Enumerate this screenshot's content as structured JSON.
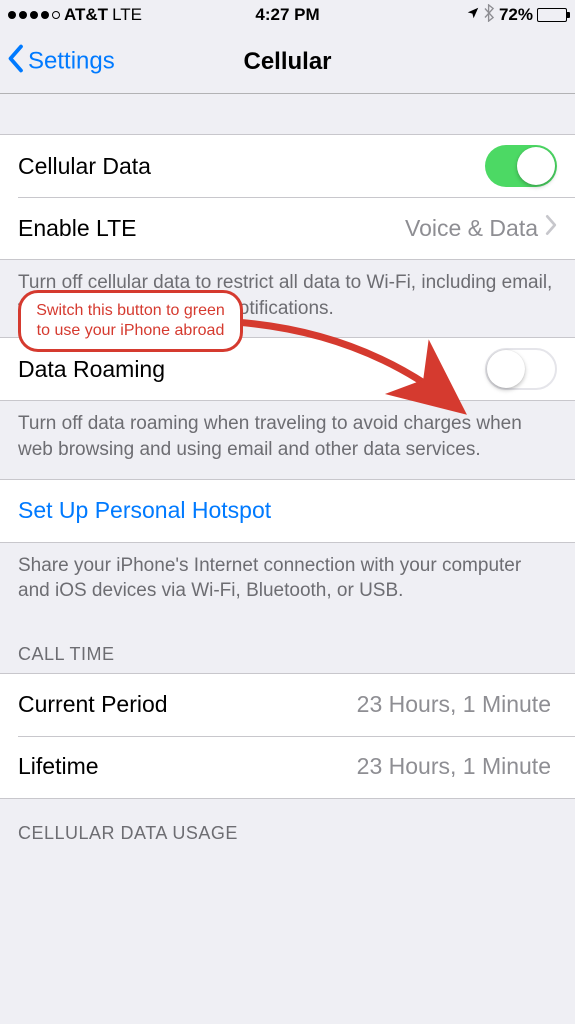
{
  "status": {
    "carrier": "AT&T",
    "network": "LTE",
    "time": "4:27 PM",
    "battery_pct": "72%"
  },
  "nav": {
    "back_label": "Settings",
    "title": "Cellular"
  },
  "rows": {
    "cellular_data": "Cellular Data",
    "enable_lte": "Enable LTE",
    "enable_lte_value": "Voice & Data",
    "cellular_data_footer": "Turn off cellular data to restrict all data to Wi-Fi, including email, web browsing, and push notifications.",
    "data_roaming": "Data Roaming",
    "data_roaming_footer": "Turn off data roaming when traveling to avoid charges when web browsing and using email and other data services.",
    "hotspot": "Set Up Personal Hotspot",
    "hotspot_footer": "Share your iPhone's Internet connection with your computer and iOS devices via Wi-Fi, Bluetooth, or USB."
  },
  "call_time": {
    "header": "CALL TIME",
    "current_label": "Current Period",
    "current_value": "23 Hours, 1 Minute",
    "lifetime_label": "Lifetime",
    "lifetime_value": "23 Hours, 1 Minute"
  },
  "usage": {
    "header": "CELLULAR DATA USAGE"
  },
  "annotation": {
    "text": "Switch this button to green to use your iPhone abroad"
  }
}
